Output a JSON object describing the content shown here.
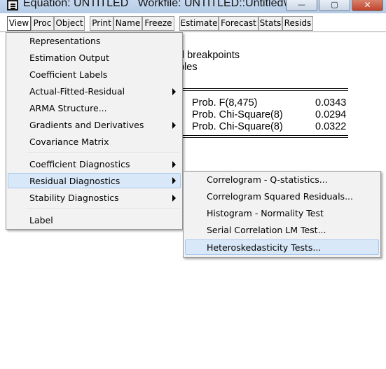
{
  "window": {
    "title": "Equation: UNTITLED   Workfile: UNTITLED::Untitled\\",
    "minimize_glyph": "—",
    "maximize_glyph": "▢",
    "close_glyph": "✕"
  },
  "toolbar": {
    "buttons": [
      "View",
      "Proc",
      "Object",
      "Print",
      "Name",
      "Freeze",
      "Estimate",
      "Forecast",
      "Stats",
      "Resids"
    ]
  },
  "output": {
    "line1": "d breakpoints",
    "line2": "ples",
    "rows": [
      {
        "label": "Prob. F(8,475)",
        "value": "0.0343"
      },
      {
        "label": "Prob. Chi-Square(8)",
        "value": "0.0294"
      },
      {
        "label": "Prob. Chi-Square(8)",
        "value": "0.0322"
      }
    ]
  },
  "view_menu": {
    "items": [
      {
        "label": "Representations",
        "submenu": false
      },
      {
        "label": "Estimation Output",
        "submenu": false
      },
      {
        "label": "Coefficient Labels",
        "submenu": false
      },
      {
        "label": "Actual-Fitted-Residual",
        "submenu": true
      },
      {
        "label": "ARMA Structure...",
        "submenu": false
      },
      {
        "label": "Gradients and Derivatives",
        "submenu": true
      },
      {
        "label": "Covariance Matrix",
        "submenu": false
      },
      {
        "label": "Coefficient Diagnostics",
        "submenu": true
      },
      {
        "label": "Residual Diagnostics",
        "submenu": true,
        "highlighted": true
      },
      {
        "label": "Stability Diagnostics",
        "submenu": true
      },
      {
        "label": "Label",
        "submenu": false
      }
    ]
  },
  "residual_submenu": {
    "items": [
      {
        "label": "Correlogram - Q-statistics..."
      },
      {
        "label": "Correlogram Squared Residuals..."
      },
      {
        "label": "Histogram - Normality Test"
      },
      {
        "label": "Serial Correlation LM Test..."
      },
      {
        "label": "Heteroskedasticity Tests...",
        "highlighted": true
      }
    ]
  },
  "colors": {
    "highlight": "#d9e8f8",
    "menu_bg": "#f2f2f2",
    "close_button": "#c0432a"
  }
}
